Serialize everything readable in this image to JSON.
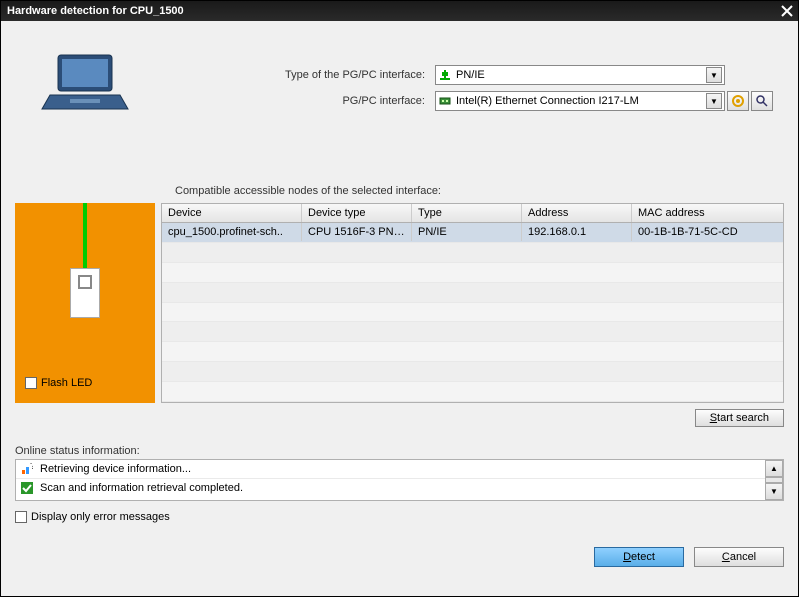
{
  "title": "Hardware detection for CPU_1500",
  "form": {
    "pgpcTypeLabel": "Type of the PG/PC interface:",
    "pgpcTypeValue": "PN/IE",
    "pgpcIfLabel": "PG/PC interface:",
    "pgpcIfValue": "Intel(R) Ethernet Connection I217-LM"
  },
  "compatibleLabel": "Compatible accessible nodes of the selected interface:",
  "table": {
    "headers": {
      "device": "Device",
      "deviceType": "Device type",
      "type": "Type",
      "address": "Address",
      "mac": "MAC address"
    },
    "rows": [
      {
        "device": "cpu_1500.profinet-sch..",
        "deviceType": "CPU 1516F-3 PN/...",
        "type": "PN/IE",
        "address": "192.168.0.1",
        "mac": "00-1B-1B-71-5C-CD"
      }
    ]
  },
  "flashLed": "Flash LED",
  "startSearch": "Start search",
  "statusLabel": "Online status information:",
  "statusLines": {
    "retrieving": "Retrieving device information...",
    "completed": "Scan and information retrieval completed."
  },
  "displayErr": "Display only error messages",
  "buttons": {
    "detect": "Detect",
    "cancel": "Cancel"
  },
  "icons": {
    "pnie": "pnie-icon",
    "nic": "nic-icon",
    "diag": "diag-icon",
    "search": "search-icon",
    "retr": "retrieving-icon",
    "ok": "check-icon"
  }
}
